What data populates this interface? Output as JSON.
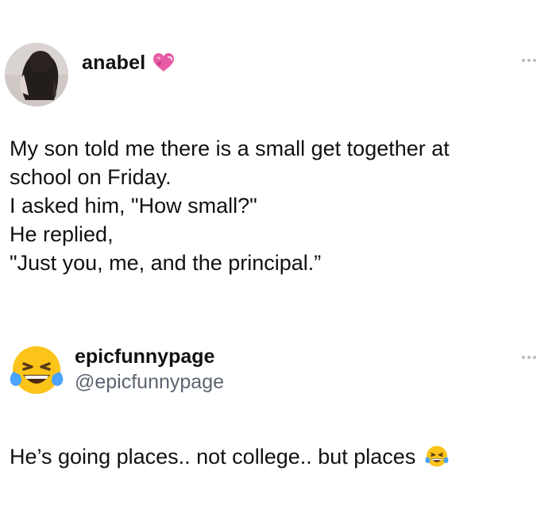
{
  "post1": {
    "username": "anabel",
    "badge_icon": "heart-with-ribbon-icon",
    "more_icon": "more-options-icon",
    "lines": [
      "My son told me there is a small get together at",
      "school on Friday.",
      "I asked him, \"How small?\"",
      "He replied,",
      "\"Just you, me, and the principal.”"
    ]
  },
  "post2": {
    "username": "epicfunnypage",
    "handle": "@epicfunnypage",
    "avatar_icon": "laughing-crying-emoji-icon",
    "more_icon": "more-options-icon",
    "text": "He’s going places.. not college.. but places",
    "trailing_icon": "laughing-crying-emoji-icon"
  },
  "colors": {
    "text": "#111111",
    "muted": "#5b6470",
    "heart": "#e85aa4",
    "emoji_yellow": "#fcc419",
    "emoji_tear": "#4aa3ff"
  }
}
